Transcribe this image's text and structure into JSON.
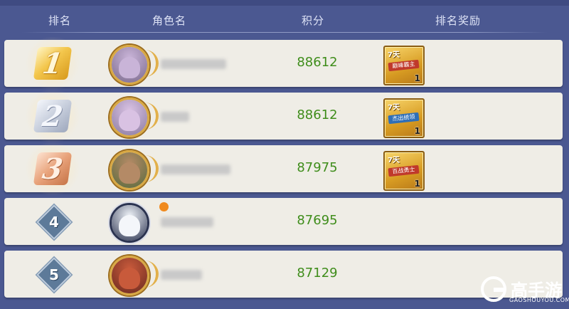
{
  "header": {
    "rank_label": "排名",
    "name_label": "角色名",
    "score_label": "积分",
    "reward_label": "排名奖励"
  },
  "rows": [
    {
      "rank": "1",
      "rank_style": "medal-gold",
      "score": "88612",
      "has_reward": true,
      "reward": {
        "days": "7天",
        "title": "巅峰霸主",
        "title_color": "#c0392b",
        "count": "1"
      },
      "avatar_colors": [
        "#7b6a8c",
        "#c9b4d8"
      ],
      "online": false,
      "name_width": 92
    },
    {
      "rank": "2",
      "rank_style": "medal-silver",
      "score": "88612",
      "has_reward": true,
      "reward": {
        "days": "7天",
        "title": "杰出统领",
        "title_color": "#2f6fb7",
        "count": "1"
      },
      "avatar_colors": [
        "#8a7aa0",
        "#d9c2e3"
      ],
      "online": false,
      "name_width": 40
    },
    {
      "rank": "3",
      "rank_style": "medal-bronze",
      "score": "87975",
      "has_reward": true,
      "reward": {
        "days": "7天",
        "title": "百战勇士",
        "title_color": "#c0392b",
        "count": "1"
      },
      "avatar_colors": [
        "#5a6b3e",
        "#b48a66"
      ],
      "online": false,
      "name_width": 98
    },
    {
      "rank": "4",
      "rank_style": "diamond",
      "score": "87695",
      "has_reward": false,
      "avatar_colors": [
        "#2b3350",
        "#eef2f7"
      ],
      "online": true,
      "name_width": 74
    },
    {
      "rank": "5",
      "rank_style": "diamond",
      "score": "87129",
      "has_reward": false,
      "avatar_colors": [
        "#6b2a20",
        "#c85a3b"
      ],
      "online": false,
      "name_width": 58
    }
  ],
  "watermark": {
    "brand": "高手游",
    "site": "GAOSHOUYOU.COM"
  }
}
